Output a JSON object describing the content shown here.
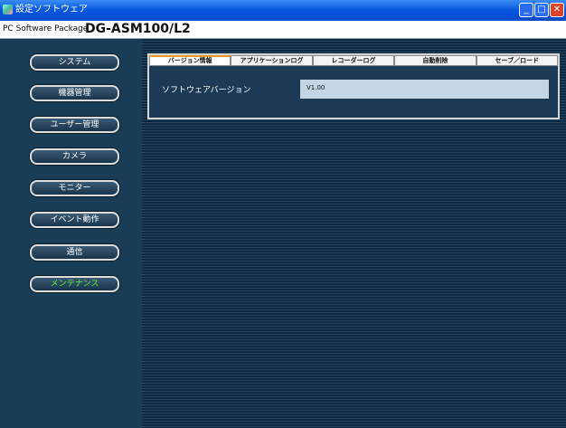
{
  "window": {
    "title": "設定ソフトウェア",
    "min_glyph": "_",
    "max_glyph": "□",
    "close_glyph": "✕"
  },
  "header": {
    "prefix": "PC Software Package",
    "product": "DG-ASM100/L2"
  },
  "nav": {
    "items": [
      "システム",
      "機器管理",
      "ユーザー管理",
      "カメラ",
      "モニター",
      "イベント動作",
      "通信",
      "メンテナンス"
    ],
    "active_index": 7,
    "active_color": "#5cf23a"
  },
  "tabs": {
    "items": [
      "バージョン情報",
      "アプリケーションログ",
      "レコーダーログ",
      "自動削除",
      "セーブ／ロード"
    ],
    "active_index": 0
  },
  "content": {
    "label": "ソフトウェアバージョン",
    "value": "V1.00"
  }
}
